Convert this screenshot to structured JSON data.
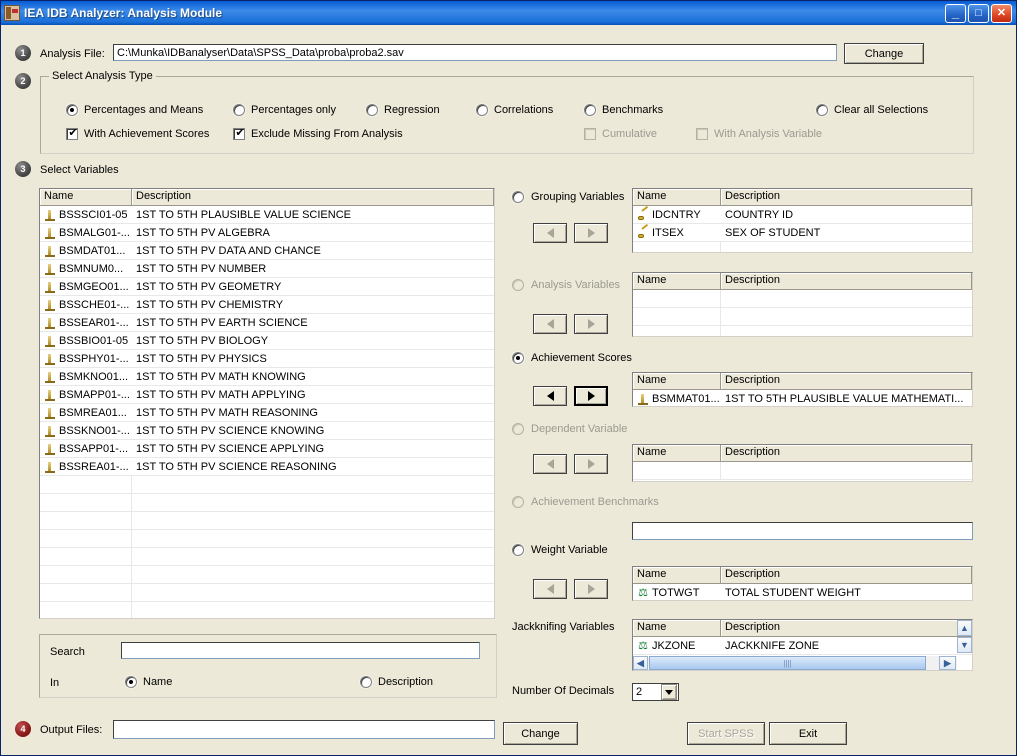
{
  "window": {
    "title": "IEA IDB Analyzer: Analysis Module",
    "minimize": "_",
    "maximize": "□",
    "close": "✕"
  },
  "step1": {
    "badge": "1",
    "label": "Analysis File:",
    "file_value": "C:\\Munka\\IDBanalyser\\Data\\SPSS_Data\\proba\\proba2.sav",
    "change_button": "Change"
  },
  "step2": {
    "badge": "2",
    "group_title": "Select Analysis Type",
    "radios": [
      {
        "label": "Percentages and Means",
        "checked": true,
        "enabled": true
      },
      {
        "label": "Percentages only",
        "checked": false,
        "enabled": true
      },
      {
        "label": "Regression",
        "checked": false,
        "enabled": true
      },
      {
        "label": "Correlations",
        "checked": false,
        "enabled": true
      },
      {
        "label": "Benchmarks",
        "checked": false,
        "enabled": true
      },
      {
        "label": "Clear all Selections",
        "checked": false,
        "enabled": true
      }
    ],
    "checkboxes": [
      {
        "label": "With Achievement Scores",
        "checked": true,
        "enabled": true
      },
      {
        "label": "Exclude Missing From Analysis",
        "checked": true,
        "enabled": true
      },
      {
        "label": "Cumulative",
        "checked": false,
        "enabled": false
      },
      {
        "label": "With Analysis Variable",
        "checked": false,
        "enabled": false
      }
    ]
  },
  "step3": {
    "badge": "3",
    "label": "Select Variables",
    "variable_list": {
      "columns": [
        "Name",
        "Description"
      ],
      "rows": [
        {
          "name": "BSSSCI01-05",
          "desc": "1ST TO 5TH PLAUSIBLE VALUE SCIENCE"
        },
        {
          "name": "BSMALG01-...",
          "desc": "1ST TO 5TH PV ALGEBRA"
        },
        {
          "name": "BSMDAT01...",
          "desc": "1ST TO 5TH PV DATA AND CHANCE"
        },
        {
          "name": "BSMNUM0...",
          "desc": "1ST TO 5TH PV NUMBER"
        },
        {
          "name": "BSMGEO01...",
          "desc": "1ST TO 5TH PV GEOMETRY"
        },
        {
          "name": "BSSCHE01-...",
          "desc": "1ST TO 5TH PV CHEMISTRY"
        },
        {
          "name": "BSSEAR01-...",
          "desc": "1ST TO 5TH PV EARTH SCIENCE"
        },
        {
          "name": "BSSBIO01-05",
          "desc": "1ST TO 5TH PV BIOLOGY"
        },
        {
          "name": "BSSPHY01-...",
          "desc": "1ST TO 5TH PV PHYSICS"
        },
        {
          "name": "BSMKNO01...",
          "desc": "1ST TO 5TH PV MATH KNOWING"
        },
        {
          "name": "BSMAPP01-...",
          "desc": "1ST TO 5TH PV MATH APPLYING"
        },
        {
          "name": "BSMREA01...",
          "desc": "1ST TO 5TH PV MATH REASONING"
        },
        {
          "name": "BSSKNO01-...",
          "desc": "1ST TO 5TH PV SCIENCE KNOWING"
        },
        {
          "name": "BSSAPP01-...",
          "desc": "1ST TO 5TH PV SCIENCE APPLYING"
        },
        {
          "name": "BSSREA01-...",
          "desc": "1ST TO 5TH PV SCIENCE REASONING"
        }
      ]
    },
    "search": {
      "label": "Search",
      "value": "",
      "in_label": "In",
      "options": [
        {
          "label": "Name",
          "checked": true
        },
        {
          "label": "Description",
          "checked": false
        }
      ]
    },
    "panels": [
      {
        "key": "grouping",
        "label": "Grouping Variables",
        "radio_checked": false,
        "enabled": true,
        "columns": [
          "Name",
          "Description"
        ],
        "rows": [
          {
            "name": "IDCNTRY",
            "desc": "COUNTRY ID",
            "icon": "categorical-icon"
          },
          {
            "name": "ITSEX",
            "desc": "SEX OF STUDENT",
            "icon": "categorical-icon"
          }
        ]
      },
      {
        "key": "analysis",
        "label": "Analysis Variables",
        "radio_checked": false,
        "enabled": false,
        "columns": [
          "Name",
          "Description"
        ],
        "rows": []
      },
      {
        "key": "achievement",
        "label": "Achievement Scores",
        "radio_checked": true,
        "enabled": true,
        "columns": [
          "Name",
          "Description"
        ],
        "rows": [
          {
            "name": "BSMMAT01...",
            "desc": "1ST TO 5TH PLAUSIBLE VALUE MATHEMATI...",
            "icon": "plausible-value-icon"
          }
        ]
      },
      {
        "key": "dependent",
        "label": "Dependent Variable",
        "radio_checked": false,
        "enabled": false,
        "columns": [
          "Name",
          "Description"
        ],
        "rows": []
      },
      {
        "key": "benchmarks",
        "label": "Achievement Benchmarks",
        "radio_checked": false,
        "enabled": false,
        "columns": [],
        "rows": []
      },
      {
        "key": "weight",
        "label": "Weight Variable",
        "radio_checked": false,
        "enabled": true,
        "columns": [
          "Name",
          "Description"
        ],
        "rows": [
          {
            "name": "TOTWGT",
            "desc": "TOTAL STUDENT WEIGHT",
            "icon": "weight-icon"
          }
        ]
      }
    ],
    "jackknifing": {
      "label": "Jackknifing Variables",
      "columns": [
        "Name",
        "Description"
      ],
      "rows": [
        {
          "name": "JKZONE",
          "desc": "JACKKNIFE ZONE",
          "icon": "weight-icon"
        }
      ],
      "scroll_up": "▲",
      "scroll_down": "▼",
      "scroll_left": "◀",
      "scroll_right": "▶"
    },
    "decimals": {
      "label": "Number Of Decimals",
      "value": "2",
      "arrow": "▼"
    }
  },
  "step4": {
    "badge": "4",
    "label": "Output Files:",
    "value": "",
    "change_button": "Change",
    "start_button": "Start SPSS",
    "start_enabled": false,
    "exit_button": "Exit"
  },
  "icons": {
    "plausible_value": "plausible-value-icon",
    "categorical": "categorical-icon",
    "weight": "⚖"
  }
}
